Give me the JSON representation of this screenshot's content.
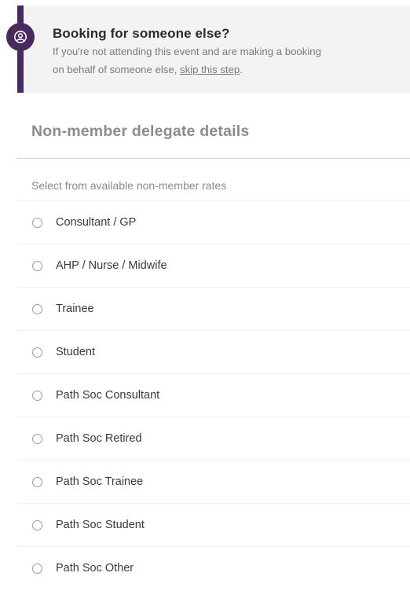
{
  "notice": {
    "title": "Booking for someone else?",
    "text_line1": "If you're not attending this event and are making a booking",
    "text_line2_prefix": "on behalf of someone else, ",
    "link_text": "skip this step",
    "text_line2_suffix": ".",
    "icon": "user-circle-icon",
    "accent_color": "#4a2a5e"
  },
  "section": {
    "title": "Non-member delegate details",
    "rates_label": "Select from available non-member rates",
    "options": [
      {
        "label": "Consultant / GP"
      },
      {
        "label": "AHP / Nurse / Midwife"
      },
      {
        "label": "Trainee"
      },
      {
        "label": "Student"
      },
      {
        "label": "Path Soc Consultant"
      },
      {
        "label": "Path Soc Retired"
      },
      {
        "label": "Path Soc Trainee"
      },
      {
        "label": "Path Soc Student"
      },
      {
        "label": "Path Soc Other"
      }
    ]
  }
}
